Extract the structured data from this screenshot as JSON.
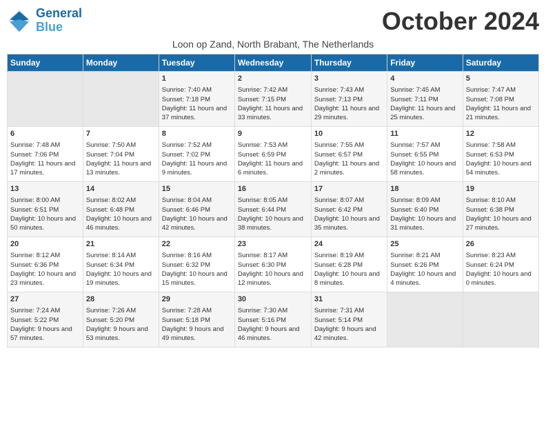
{
  "header": {
    "logo_line1": "General",
    "logo_line2": "Blue",
    "month_title": "October 2024",
    "subtitle": "Loon op Zand, North Brabant, The Netherlands"
  },
  "days_of_week": [
    "Sunday",
    "Monday",
    "Tuesday",
    "Wednesday",
    "Thursday",
    "Friday",
    "Saturday"
  ],
  "weeks": [
    [
      {
        "day": "",
        "content": ""
      },
      {
        "day": "",
        "content": ""
      },
      {
        "day": "1",
        "content": "Sunrise: 7:40 AM\nSunset: 7:18 PM\nDaylight: 11 hours and 37 minutes."
      },
      {
        "day": "2",
        "content": "Sunrise: 7:42 AM\nSunset: 7:15 PM\nDaylight: 11 hours and 33 minutes."
      },
      {
        "day": "3",
        "content": "Sunrise: 7:43 AM\nSunset: 7:13 PM\nDaylight: 11 hours and 29 minutes."
      },
      {
        "day": "4",
        "content": "Sunrise: 7:45 AM\nSunset: 7:11 PM\nDaylight: 11 hours and 25 minutes."
      },
      {
        "day": "5",
        "content": "Sunrise: 7:47 AM\nSunset: 7:08 PM\nDaylight: 11 hours and 21 minutes."
      }
    ],
    [
      {
        "day": "6",
        "content": "Sunrise: 7:48 AM\nSunset: 7:06 PM\nDaylight: 11 hours and 17 minutes."
      },
      {
        "day": "7",
        "content": "Sunrise: 7:50 AM\nSunset: 7:04 PM\nDaylight: 11 hours and 13 minutes."
      },
      {
        "day": "8",
        "content": "Sunrise: 7:52 AM\nSunset: 7:02 PM\nDaylight: 11 hours and 9 minutes."
      },
      {
        "day": "9",
        "content": "Sunrise: 7:53 AM\nSunset: 6:59 PM\nDaylight: 11 hours and 6 minutes."
      },
      {
        "day": "10",
        "content": "Sunrise: 7:55 AM\nSunset: 6:57 PM\nDaylight: 11 hours and 2 minutes."
      },
      {
        "day": "11",
        "content": "Sunrise: 7:57 AM\nSunset: 6:55 PM\nDaylight: 10 hours and 58 minutes."
      },
      {
        "day": "12",
        "content": "Sunrise: 7:58 AM\nSunset: 6:53 PM\nDaylight: 10 hours and 54 minutes."
      }
    ],
    [
      {
        "day": "13",
        "content": "Sunrise: 8:00 AM\nSunset: 6:51 PM\nDaylight: 10 hours and 50 minutes."
      },
      {
        "day": "14",
        "content": "Sunrise: 8:02 AM\nSunset: 6:48 PM\nDaylight: 10 hours and 46 minutes."
      },
      {
        "day": "15",
        "content": "Sunrise: 8:04 AM\nSunset: 6:46 PM\nDaylight: 10 hours and 42 minutes."
      },
      {
        "day": "16",
        "content": "Sunrise: 8:05 AM\nSunset: 6:44 PM\nDaylight: 10 hours and 38 minutes."
      },
      {
        "day": "17",
        "content": "Sunrise: 8:07 AM\nSunset: 6:42 PM\nDaylight: 10 hours and 35 minutes."
      },
      {
        "day": "18",
        "content": "Sunrise: 8:09 AM\nSunset: 6:40 PM\nDaylight: 10 hours and 31 minutes."
      },
      {
        "day": "19",
        "content": "Sunrise: 8:10 AM\nSunset: 6:38 PM\nDaylight: 10 hours and 27 minutes."
      }
    ],
    [
      {
        "day": "20",
        "content": "Sunrise: 8:12 AM\nSunset: 6:36 PM\nDaylight: 10 hours and 23 minutes."
      },
      {
        "day": "21",
        "content": "Sunrise: 8:14 AM\nSunset: 6:34 PM\nDaylight: 10 hours and 19 minutes."
      },
      {
        "day": "22",
        "content": "Sunrise: 8:16 AM\nSunset: 6:32 PM\nDaylight: 10 hours and 15 minutes."
      },
      {
        "day": "23",
        "content": "Sunrise: 8:17 AM\nSunset: 6:30 PM\nDaylight: 10 hours and 12 minutes."
      },
      {
        "day": "24",
        "content": "Sunrise: 8:19 AM\nSunset: 6:28 PM\nDaylight: 10 hours and 8 minutes."
      },
      {
        "day": "25",
        "content": "Sunrise: 8:21 AM\nSunset: 6:26 PM\nDaylight: 10 hours and 4 minutes."
      },
      {
        "day": "26",
        "content": "Sunrise: 8:23 AM\nSunset: 6:24 PM\nDaylight: 10 hours and 0 minutes."
      }
    ],
    [
      {
        "day": "27",
        "content": "Sunrise: 7:24 AM\nSunset: 5:22 PM\nDaylight: 9 hours and 57 minutes."
      },
      {
        "day": "28",
        "content": "Sunrise: 7:26 AM\nSunset: 5:20 PM\nDaylight: 9 hours and 53 minutes."
      },
      {
        "day": "29",
        "content": "Sunrise: 7:28 AM\nSunset: 5:18 PM\nDaylight: 9 hours and 49 minutes."
      },
      {
        "day": "30",
        "content": "Sunrise: 7:30 AM\nSunset: 5:16 PM\nDaylight: 9 hours and 46 minutes."
      },
      {
        "day": "31",
        "content": "Sunrise: 7:31 AM\nSunset: 5:14 PM\nDaylight: 9 hours and 42 minutes."
      },
      {
        "day": "",
        "content": ""
      },
      {
        "day": "",
        "content": ""
      }
    ]
  ]
}
